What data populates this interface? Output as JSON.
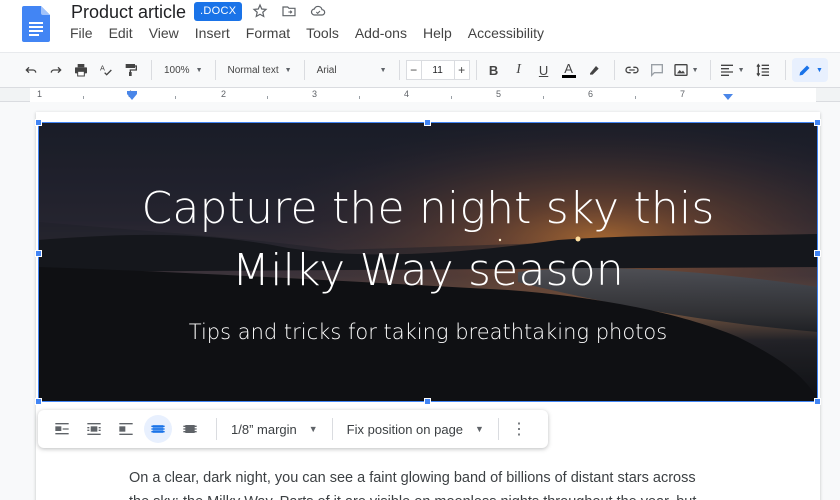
{
  "document": {
    "title": "Product article",
    "format_badge": ".DOCX"
  },
  "menu": [
    "File",
    "Edit",
    "View",
    "Insert",
    "Format",
    "Tools",
    "Add-ons",
    "Help",
    "Accessibility"
  ],
  "toolbar": {
    "zoom": "100%",
    "style": "Normal text",
    "font": "Arial",
    "font_size": "11",
    "bold": "B",
    "italic": "I",
    "underline": "U",
    "text_color": "A",
    "minus": "−",
    "plus": "+"
  },
  "ruler": {
    "numbers": [
      "1",
      "1",
      "2",
      "3",
      "4",
      "5",
      "6",
      "7"
    ]
  },
  "hero": {
    "title_line1": "Capture the night sky this",
    "title_line2": "Milky Way season",
    "subtitle": "Tips and tricks for taking breathtaking photos"
  },
  "image_options": {
    "margin": "1/8” margin",
    "position": "Fix position on page",
    "more": "⋮"
  },
  "body": {
    "line1": "On a clear, dark night, you can see a faint glowing band of billions of distant stars across",
    "line2": "the sky: the Milky Way. Parts of it are visible on moonless nights throughout the year, but"
  },
  "colors": {
    "accent": "#1a73e8",
    "selection": "#4285f4"
  }
}
